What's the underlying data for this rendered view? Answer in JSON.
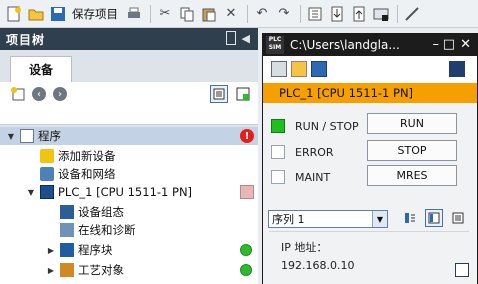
{
  "toolbar": {
    "save_label": "保存项目",
    "icons": [
      "new-project-icon",
      "open-project-icon",
      "save-icon",
      "print-icon",
      "cut-icon",
      "copy-icon",
      "paste-icon",
      "delete-icon",
      "undo-icon",
      "redo-icon",
      "compile-icon",
      "download-icon",
      "upload-icon",
      "simulate-icon",
      "go-online-icon"
    ]
  },
  "project_tree": {
    "title": "项目树",
    "tab": "设备",
    "items": [
      {
        "label": "程序",
        "icon": "project-icon",
        "expanded": true,
        "status": "error"
      },
      {
        "label": "添加新设备",
        "icon": "add-device-icon"
      },
      {
        "label": "设备和网络",
        "icon": "network-icon"
      },
      {
        "label": "PLC_1 [CPU 1511-1 PN]",
        "icon": "cpu-icon",
        "expanded": true,
        "status": "warning"
      },
      {
        "label": "设备组态",
        "icon": "device-config-icon"
      },
      {
        "label": "在线和诊断",
        "icon": "diagnostics-icon"
      },
      {
        "label": "程序块",
        "icon": "program-blocks-icon",
        "expanded": false,
        "status": "ok"
      },
      {
        "label": "工艺对象",
        "icon": "technology-objects-icon",
        "expanded": false,
        "status": "ok"
      }
    ]
  },
  "plcsim": {
    "window_title": "C:\\Users\\landgla...",
    "logo_line1": "PLC",
    "logo_line2": "SIM",
    "device": "PLC_1 [CPU 1511-1 PN]",
    "leds": [
      {
        "label": "RUN / STOP",
        "state": "on",
        "color": "#1fbf1f"
      },
      {
        "label": "ERROR",
        "state": "off"
      },
      {
        "label": "MAINT",
        "state": "off"
      }
    ],
    "buttons": {
      "run": "RUN",
      "stop": "STOP",
      "mres": "MRES"
    },
    "serial_select": "序列 1",
    "ip_label": "IP 地址：",
    "ip_value": "192.168.0.10"
  }
}
